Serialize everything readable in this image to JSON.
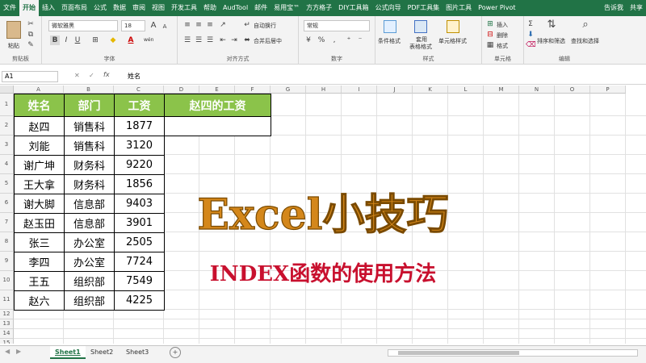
{
  "menu": {
    "tabs": [
      "文件",
      "开始",
      "插入",
      "页面布局",
      "公式",
      "数据",
      "审阅",
      "视图",
      "开发工具",
      "帮助",
      "AudTool",
      "邮件",
      "易用宝™",
      "方方格子",
      "DIY工具箱",
      "公式向导",
      "PDF工具集",
      "图片工具",
      "Power Pivot",
      "告诉我",
      "共享"
    ],
    "active": 1
  },
  "ribbon": {
    "clipboard": {
      "paste": "粘贴",
      "label": "剪贴板"
    },
    "font": {
      "name": "微软雅黑",
      "size": "18",
      "bold": "B",
      "italic": "I",
      "underline": "U",
      "grow": "A",
      "shrink": "A",
      "color_letter": "A",
      "wen": "wén",
      "label": "字体"
    },
    "align": {
      "wrap": "自动换行",
      "merge": "合并后居中",
      "label": "对齐方式"
    },
    "number": {
      "format": "常规",
      "percent": "%",
      "comma": ",",
      "label": "数字"
    },
    "styles": {
      "cond": "条件格式",
      "table1": "套用",
      "table2": "表格格式",
      "cell": "单元格样式",
      "label": "样式"
    },
    "cells": {
      "insert": "插入",
      "delete": "删除",
      "format": "格式",
      "label": "单元格"
    },
    "editing": {
      "sigma": "Σ",
      "sort": "排序和筛选",
      "find": "查找和选择",
      "label": "编辑"
    }
  },
  "formula_bar": {
    "name_box": "A1",
    "fx": "fx",
    "content": "姓名"
  },
  "columns": [
    "A",
    "B",
    "C",
    "D",
    "E",
    "F",
    "G",
    "H",
    "I",
    "J",
    "K",
    "L",
    "M",
    "N",
    "O",
    "P"
  ],
  "rows": [
    "1",
    "2",
    "3",
    "4",
    "5",
    "6",
    "7",
    "8",
    "9",
    "10",
    "11",
    "12",
    "13",
    "14",
    "15"
  ],
  "table": {
    "headers": [
      "姓名",
      "部门",
      "工资"
    ],
    "rows": [
      [
        "赵四",
        "销售科",
        "1877"
      ],
      [
        "刘能",
        "销售科",
        "3120"
      ],
      [
        "谢广坤",
        "财务科",
        "9220"
      ],
      [
        "王大拿",
        "财务科",
        "1856"
      ],
      [
        "谢大脚",
        "信息部",
        "9403"
      ],
      [
        "赵玉田",
        "信息部",
        "3901"
      ],
      [
        "张三",
        "办公室",
        "2505"
      ],
      [
        "李四",
        "办公室",
        "7724"
      ],
      [
        "王五",
        "组织部",
        "7549"
      ],
      [
        "赵六",
        "组织部",
        "4225"
      ]
    ]
  },
  "lookup": {
    "header": "赵四的工资",
    "value": ""
  },
  "overlay": {
    "title": "Excel小技巧",
    "subtitle": "INDEX函数的使用方法",
    "title_color": "#d4871b",
    "subtitle_color": "#c8102e"
  },
  "sheet_tabs": [
    "Sheet1",
    "Sheet2",
    "Sheet3"
  ],
  "active_sheet": 0,
  "accent": "#217346",
  "header_fill": "#8bc34a"
}
